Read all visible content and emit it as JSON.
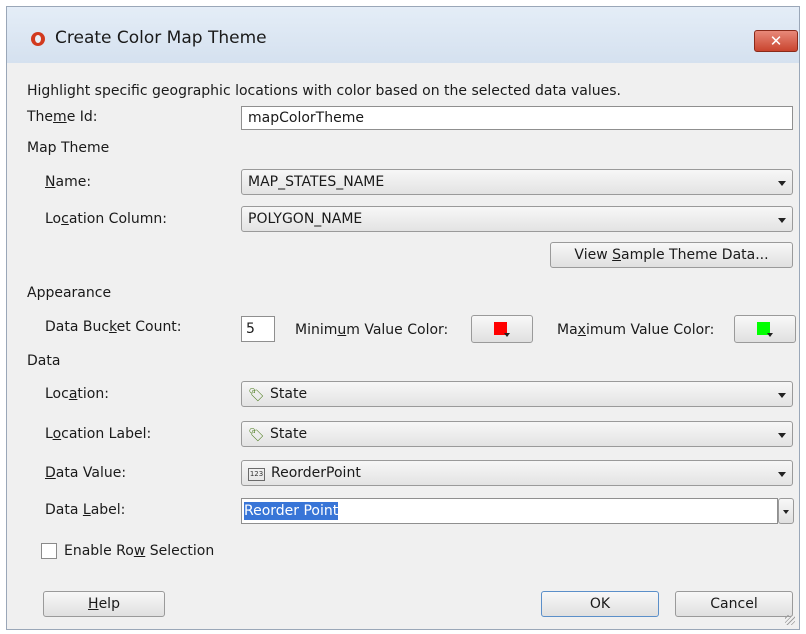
{
  "window": {
    "title": "Create Color Map Theme",
    "close_glyph": "✕"
  },
  "description": "Highlight specific geographic locations with color based on the selected data values.",
  "theme_id": {
    "label_pre": "The",
    "label_mn": "m",
    "label_post": "e Id:",
    "value": "mapColorTheme"
  },
  "map_theme": {
    "heading": "Map Theme",
    "name": {
      "label_mn": "N",
      "label_post": "ame:",
      "value": "MAP_STATES_NAME"
    },
    "location_column": {
      "label_pre": "Lo",
      "label_mn": "c",
      "label_post": "ation Column:",
      "value": "POLYGON_NAME"
    },
    "view_button": {
      "pre": "View ",
      "mn": "S",
      "post": "ample Theme Data..."
    }
  },
  "appearance": {
    "heading": "Appearance",
    "bucket_count": {
      "label_pre": "Data Buc",
      "label_mn": "k",
      "label_post": "et Count:",
      "value": "5"
    },
    "min_color": {
      "label_pre": "Minim",
      "label_mn": "u",
      "label_post": "m Value Color:",
      "color": "#ff0000"
    },
    "max_color": {
      "label_pre": "Ma",
      "label_mn": "x",
      "label_post": "imum Value Color:",
      "color": "#00ff00"
    }
  },
  "data": {
    "heading": "Data",
    "location": {
      "label_pre": "Loc",
      "label_mn": "a",
      "label_post": "tion:",
      "value": "State",
      "icon": "tag-icon"
    },
    "location_label": {
      "label_pre": "L",
      "label_mn": "o",
      "label_post": "cation Label:",
      "value": "State",
      "icon": "tag-icon"
    },
    "data_value": {
      "label_mn": "D",
      "label_post": "ata Value:",
      "value": "ReorderPoint",
      "icon": "number-icon"
    },
    "data_label": {
      "label_pre": "Data ",
      "label_mn": "L",
      "label_post": "abel:",
      "value": "Reorder Point"
    }
  },
  "row_selection": {
    "label_pre": "Enable Ro",
    "label_mn": "w",
    "label_post": " Selection",
    "checked": false
  },
  "buttons": {
    "help": {
      "mn": "H",
      "post": "elp"
    },
    "ok": "OK",
    "cancel": "Cancel"
  },
  "colors": {
    "title_bar": "#dbe6f3",
    "selection": "#3875d7",
    "close": "#c9442e"
  }
}
